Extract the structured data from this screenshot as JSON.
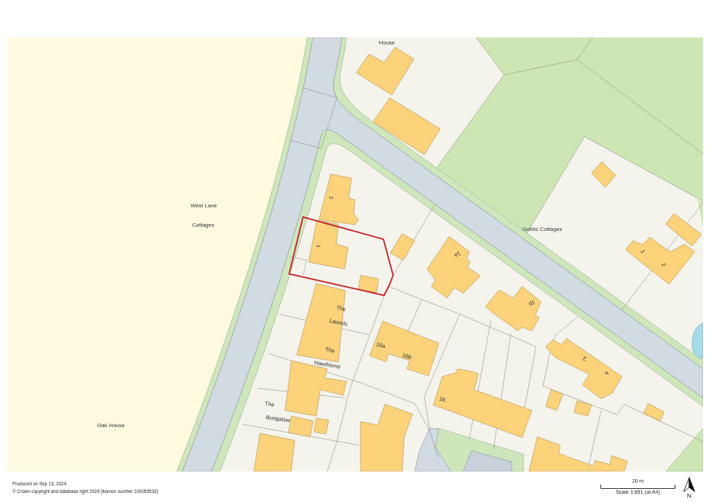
{
  "map": {
    "labels": [
      {
        "lines": [
          "House"
        ]
      },
      {
        "lines": [
          "West Lane",
          "Cottages"
        ]
      },
      {
        "lines": [
          "Gothic Cottages"
        ]
      },
      {
        "lines": [
          "The",
          "Laurels"
        ]
      },
      {
        "lines": [
          "The",
          "Hawthorns"
        ]
      },
      {
        "lines": [
          "The",
          "Bungalow"
        ]
      },
      {
        "lines": [
          "Oak House"
        ]
      }
    ],
    "house_numbers": [
      "2",
      "1",
      "1a",
      "1",
      "2",
      "1b",
      "16a",
      "16b",
      "2",
      "4",
      "16"
    ]
  },
  "footer": {
    "produced": "Produced on Sep 13, 2024.",
    "copyright": "© Crown copyright and database right 2024 (licence number 100059532)"
  },
  "scale_bar": {
    "distance": "20 m",
    "scale": "Scale 1:651 (at A4)"
  },
  "north_arrow": {
    "letter": "N"
  }
}
